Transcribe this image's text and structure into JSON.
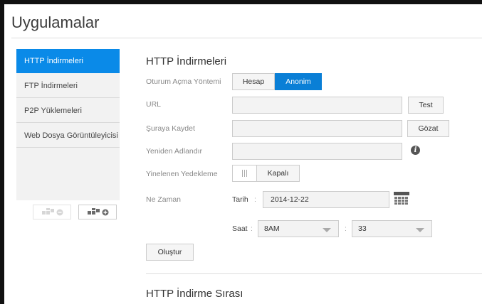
{
  "page": {
    "title": "Uygulamalar"
  },
  "sidebar": {
    "items": [
      {
        "label": "HTTP İndirmeleri",
        "active": true
      },
      {
        "label": "FTP İndirmeleri",
        "active": false
      },
      {
        "label": "P2P Yüklemeleri",
        "active": false
      },
      {
        "label": "Web Dosya Görüntüleyicisi",
        "active": false
      }
    ]
  },
  "main": {
    "section_title": "HTTP İndirmeleri",
    "login_method": {
      "label": "Oturum Açma Yöntemi",
      "options": [
        "Hesap",
        "Anonim"
      ],
      "selected": "Anonim"
    },
    "url": {
      "label": "URL",
      "value": "",
      "button": "Test"
    },
    "save_to": {
      "label": "Şuraya Kaydet",
      "value": "",
      "button": "Gözat"
    },
    "rename": {
      "label": "Yeniden Adlandır",
      "value": ""
    },
    "recurring_backup": {
      "label": "Yinelenen Yedekleme",
      "state": "Kapalı"
    },
    "when": {
      "label": "Ne Zaman",
      "date_label": "Tarih",
      "date_value": "2014-12-22",
      "time_label": "Saat",
      "hour_value": "8AM",
      "minute_value": "33",
      "separator": ":"
    },
    "create_button": "Oluştur",
    "queue_title": "HTTP İndirme Sırası"
  },
  "colors": {
    "accent": "#0a8ae8",
    "button_blue": "#0a7fd6"
  }
}
